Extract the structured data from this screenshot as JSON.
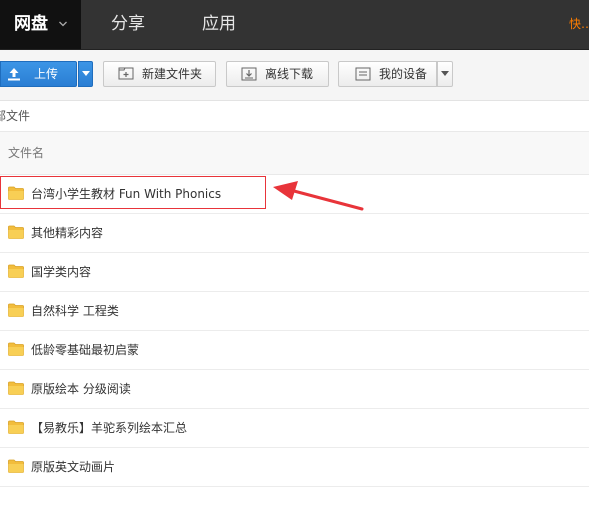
{
  "nav": {
    "tabs": [
      {
        "label": "网盘",
        "active": true
      },
      {
        "label": "分享",
        "active": false
      },
      {
        "label": "应用",
        "active": false
      }
    ],
    "right_text": "快…"
  },
  "toolbar": {
    "upload_label": "上传",
    "new_folder_label": "新建文件夹",
    "offline_download_label": "离线下载",
    "my_devices_label": "我的设备"
  },
  "breadcrumb": {
    "text": "部文件"
  },
  "list": {
    "header_name": "文件名",
    "items": [
      {
        "name": "台湾小学生教材 Fun With Phonics",
        "icon": "folder-icon"
      },
      {
        "name": "其他精彩内容",
        "icon": "folder-icon"
      },
      {
        "name": "国学类内容",
        "icon": "folder-icon"
      },
      {
        "name": "自然科学 工程类",
        "icon": "folder-icon"
      },
      {
        "name": "低龄零基础最初启蒙",
        "icon": "folder-icon"
      },
      {
        "name": "原版绘本 分级阅读",
        "icon": "folder-icon"
      },
      {
        "name": "【易教乐】羊驼系列绘本汇总",
        "icon": "folder-icon"
      },
      {
        "name": "原版英文动画片",
        "icon": "folder-icon"
      }
    ]
  },
  "colors": {
    "nav_bg": "#333333",
    "nav_active_bg": "#111111",
    "upload_blue": "#2a7ed3",
    "folder_yellow": "#f5c543",
    "annotation_red": "#e8343a"
  }
}
